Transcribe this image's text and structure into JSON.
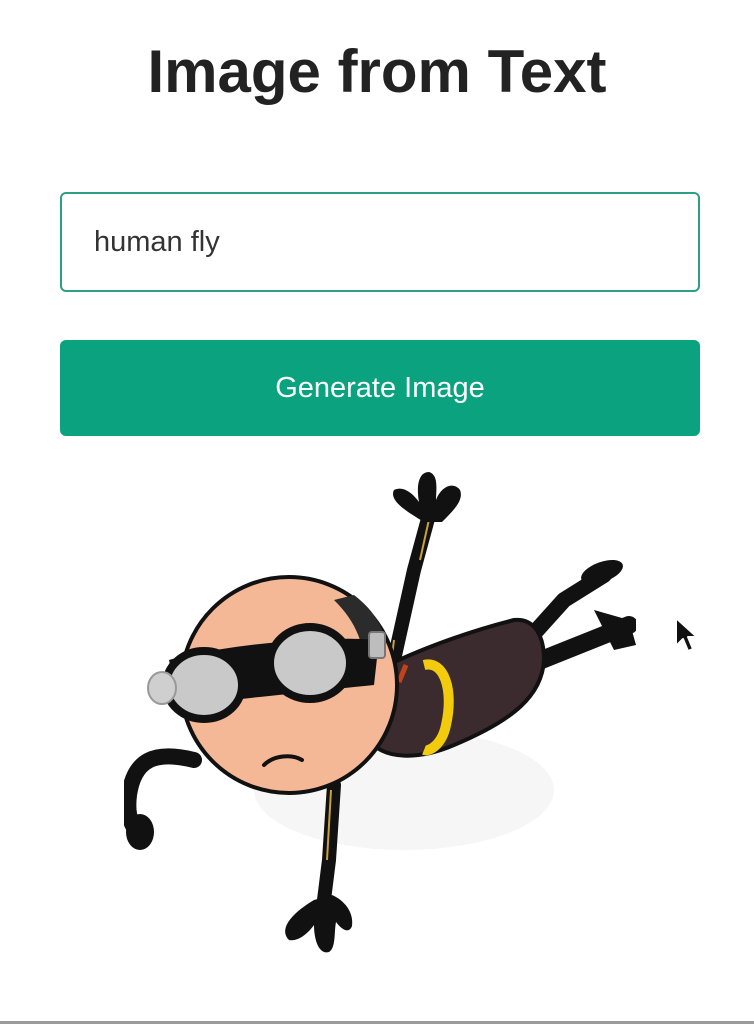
{
  "header": {
    "title": "Image from Text"
  },
  "prompt": {
    "value": "human fly"
  },
  "actions": {
    "generate_label": "Generate Image"
  },
  "result": {
    "image_alt": "cartoon bald man in goggles flying"
  },
  "colors": {
    "accent": "#0ba37f",
    "input_border": "#2e9f84",
    "title": "#222222"
  }
}
